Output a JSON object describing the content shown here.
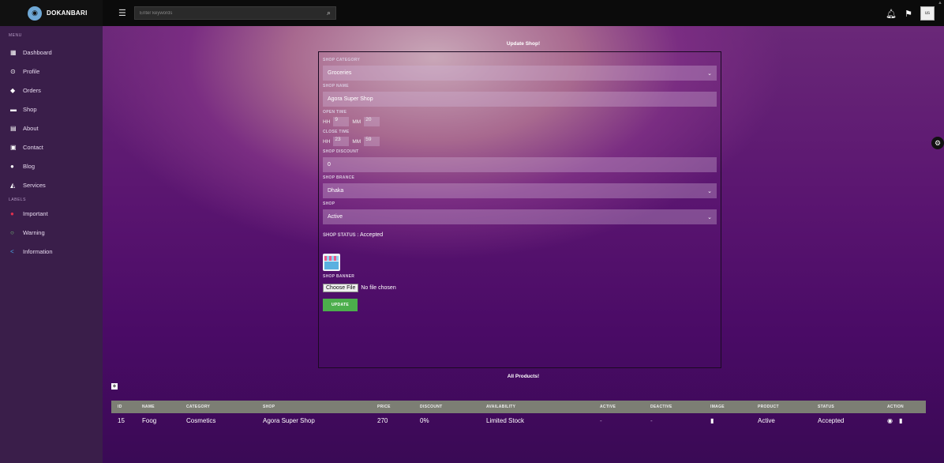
{
  "brand": {
    "name": "DOKANBARI",
    "logo_icon": "store-logo"
  },
  "search": {
    "placeholder": "Enter keywords"
  },
  "topbar": {
    "avatar_alt": "us"
  },
  "sidebar": {
    "menu_header": "MENU",
    "items": [
      {
        "label": "Dashboard",
        "icon": "dashboard-icon"
      },
      {
        "label": "Profile",
        "icon": "profile-icon"
      },
      {
        "label": "Orders",
        "icon": "tag-icon"
      },
      {
        "label": "Shop",
        "icon": "shop-icon"
      },
      {
        "label": "About",
        "icon": "about-icon"
      },
      {
        "label": "Contact",
        "icon": "contact-icon"
      },
      {
        "label": "Blog",
        "icon": "blog-icon"
      },
      {
        "label": "Services",
        "icon": "services-icon"
      }
    ],
    "labels_header": "LABELS",
    "labels": [
      {
        "label": "Important",
        "color": "#e0304e"
      },
      {
        "label": "Warning",
        "color": "#7bd67b"
      },
      {
        "label": "Information",
        "color": "#4aa8e8"
      }
    ]
  },
  "form": {
    "title": "Update Shop!",
    "category_label": "SHOP CATEGORY",
    "category_value": "Groceries",
    "name_label": "SHOP NAME",
    "name_value": "Agora Super Shop",
    "open_label": "OPEN TIME",
    "open_hh_label": "HH",
    "open_hh": "9",
    "open_mm_label": "MM",
    "open_mm": "20",
    "close_label": "CLOSE TIME",
    "close_hh_label": "HH",
    "close_hh": "23",
    "close_mm_label": "MM",
    "close_mm": "59",
    "discount_label": "SHOP DISCOUNT",
    "discount_value": "0",
    "branch_label": "SHOP BRANCE",
    "branch_value": "Dhaka",
    "shop_label": "SHOP",
    "shop_value": "Active",
    "status_label": "SHOP STATUS :",
    "status_value": "Accepted",
    "banner_label": "SHOP BANNER",
    "choose_file": "Choose File",
    "no_file": "No file chosen",
    "update_button": "UPDATE"
  },
  "products": {
    "title": "All Products!",
    "add_icon": "plus-icon",
    "headers": [
      "ID",
      "NAME",
      "CATEGORY",
      "SHOP",
      "PRICE",
      "DISCOUNT",
      "AVAILABILITY",
      "ACTIVE",
      "DEACTIVE",
      "IMAGE",
      "PRODUCT",
      "STATUS",
      "ACTION"
    ],
    "rows": [
      {
        "id": "15",
        "name": "Foog",
        "category": "Cosmetics",
        "shop": "Agora Super Shop",
        "price": "270",
        "discount": "0%",
        "availability": "Limited Stock",
        "active": "-",
        "deactive": "-",
        "product": "Active",
        "status": "Accepted"
      }
    ]
  }
}
